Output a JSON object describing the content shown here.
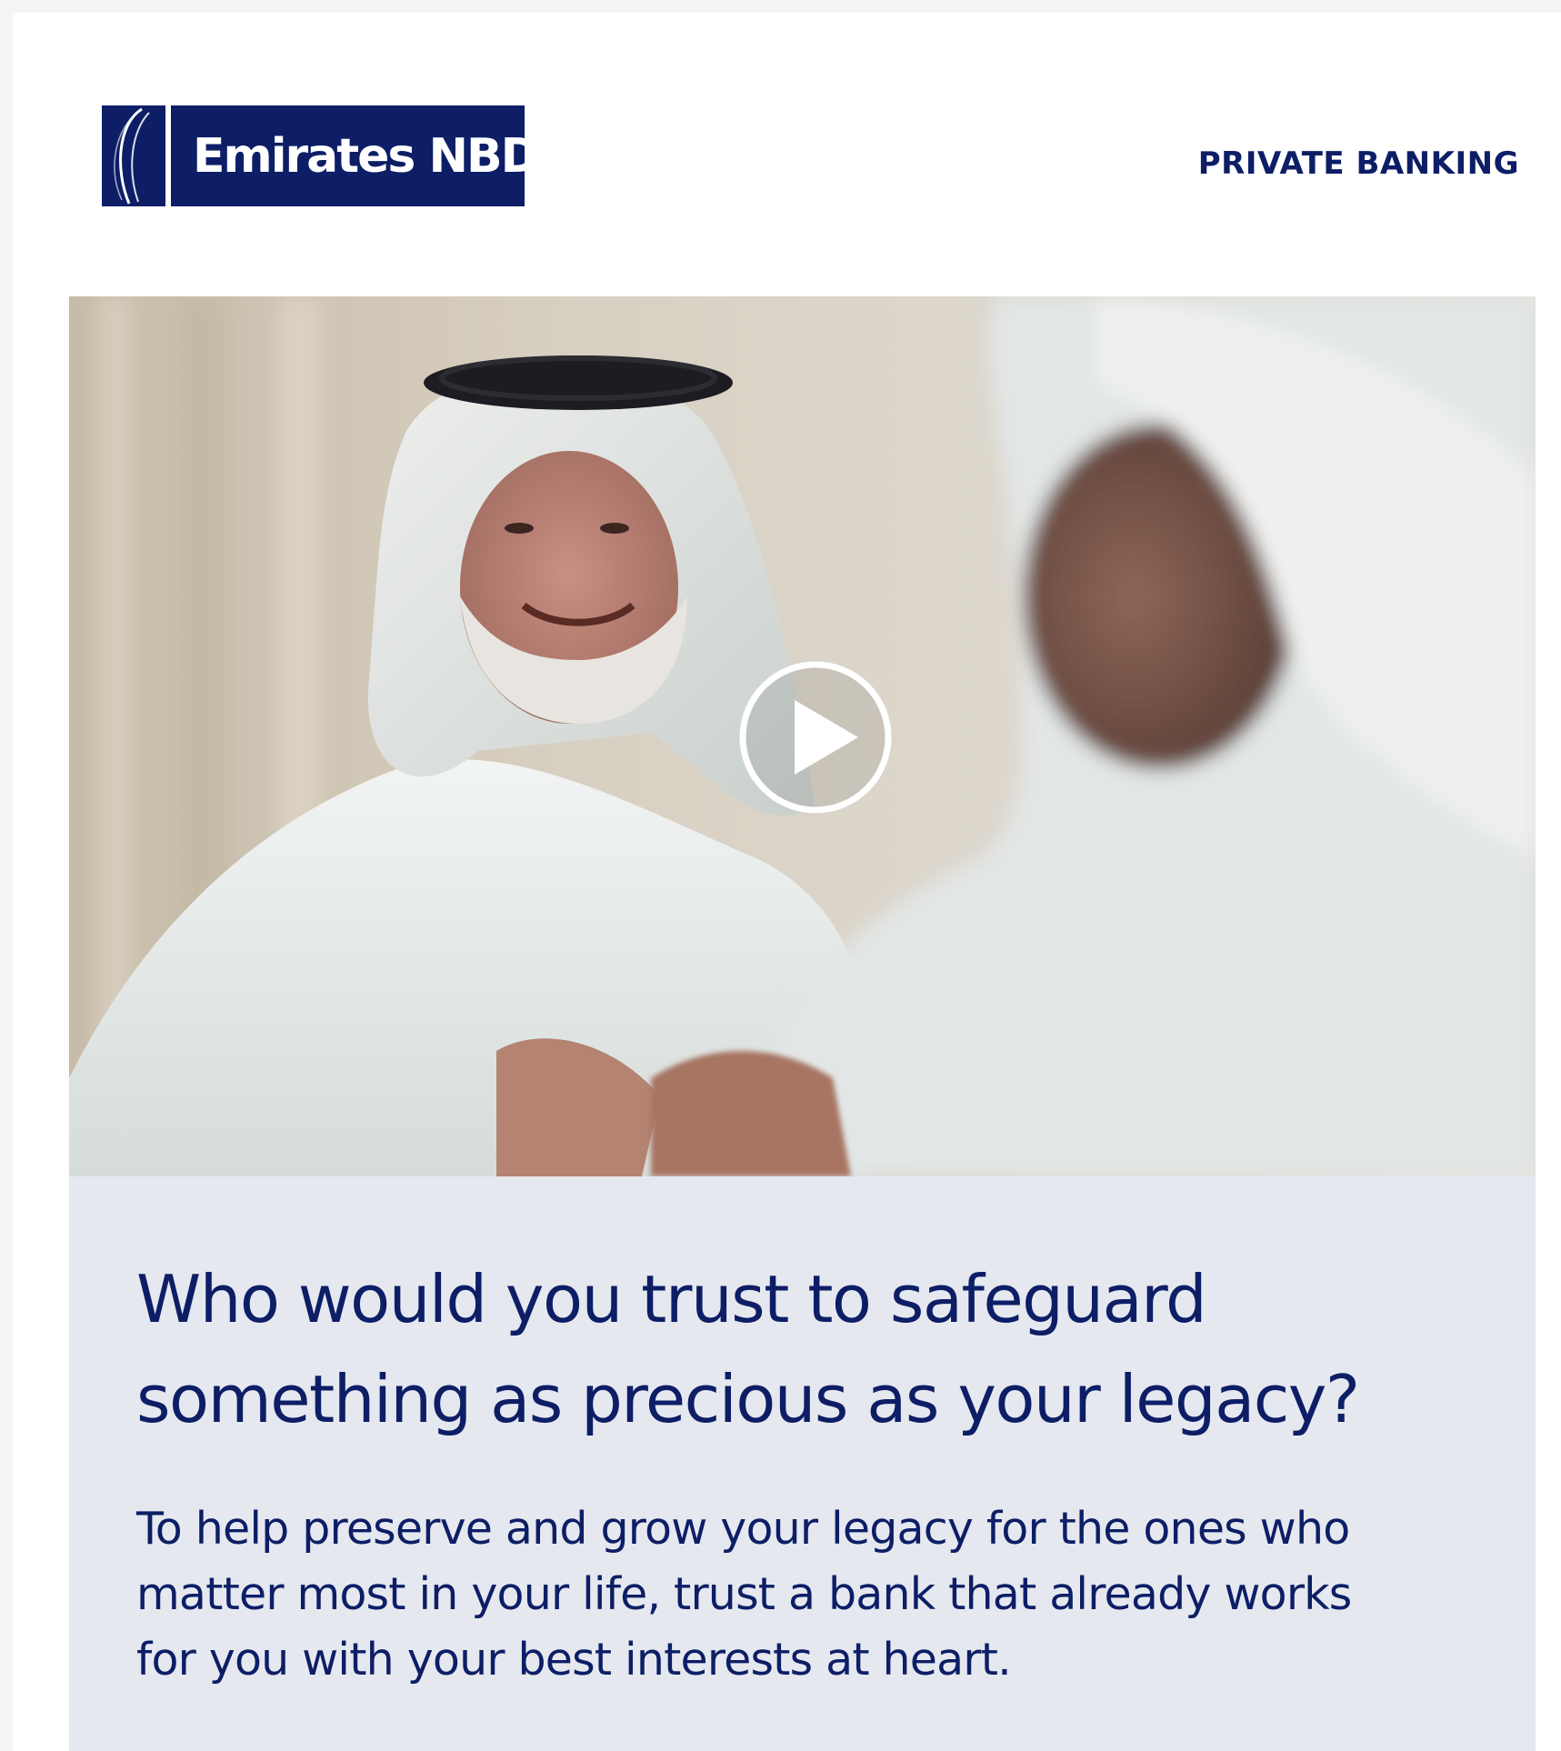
{
  "header": {
    "logo_text": "Emirates NBD",
    "section_label": "PRIVATE BANKING"
  },
  "hero": {
    "play_icon": "play-circle-icon"
  },
  "content": {
    "headline_lines": [
      "Who would you trust to safeguard",
      "something as precious as your legacy?"
    ],
    "body_lines": [
      "To help preserve and grow your legacy for the ones who",
      "matter most in your life, trust a bank that already works",
      "for you with your best interests at heart."
    ]
  },
  "colors": {
    "brand_navy": "#0d1e66",
    "panel_bg": "#e5e8ef",
    "page_bg": "#ffffff"
  }
}
